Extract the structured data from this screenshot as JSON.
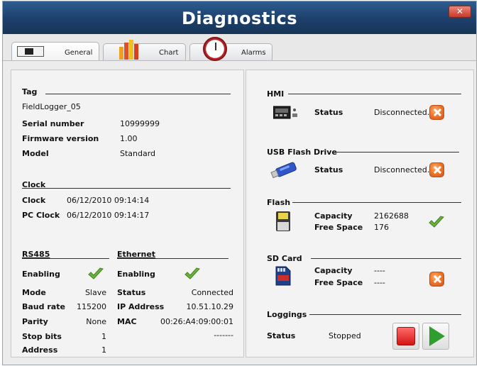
{
  "window": {
    "title": "Diagnostics",
    "close_symbol": "✕"
  },
  "tabs": [
    {
      "label": "General",
      "icon": "tag-grid-icon",
      "active": true
    },
    {
      "label": "Chart",
      "icon": "bar-chart-icon",
      "active": false
    },
    {
      "label": "Alarms",
      "icon": "alarm-clock-icon",
      "active": false
    }
  ],
  "general": {
    "tag": {
      "title": "Tag",
      "name": "FieldLogger_05",
      "rows": [
        {
          "label": "Serial number",
          "value": "10999999"
        },
        {
          "label": "Firmware version",
          "value": "1.00"
        },
        {
          "label": "Model",
          "value": "Standard"
        }
      ]
    },
    "clock": {
      "title": "Clock",
      "rows": [
        {
          "label": "Clock",
          "value": "06/12/2010 09:14:14"
        },
        {
          "label": "PC Clock",
          "value": "06/12/2010 09:14:17"
        }
      ]
    },
    "rs485": {
      "title": "RS485",
      "enabling_label": "Enabling",
      "enabled": true,
      "rows": [
        {
          "label": "Mode",
          "value": "Slave"
        },
        {
          "label": "Baud rate",
          "value": "115200"
        },
        {
          "label": "Parity",
          "value": "None"
        },
        {
          "label": "Stop bits",
          "value": "1"
        },
        {
          "label": "Address",
          "value": "1"
        }
      ]
    },
    "ethernet": {
      "title": "Ethernet",
      "enabling_label": "Enabling",
      "enabled": true,
      "rows": [
        {
          "label": "Status",
          "value": "Connected"
        },
        {
          "label": "IP Address",
          "value": "10.51.10.29"
        },
        {
          "label": "MAC",
          "value": "00:26:A4:09:00:01"
        },
        {
          "label": "",
          "value": "-------"
        }
      ]
    }
  },
  "devices": {
    "hmi": {
      "title": "HMI",
      "status_label": "Status",
      "status_value": "Disconnected."
    },
    "usb": {
      "title": "USB Flash Drive",
      "status_label": "Status",
      "status_value": "Disconnected."
    },
    "flash": {
      "title": "Flash",
      "capacity_label": "Capacity",
      "capacity_value": "2162688",
      "free_label": "Free Space",
      "free_value": "176"
    },
    "sdcard": {
      "title": "SD Card",
      "capacity_label": "Capacity",
      "capacity_value": "----",
      "free_label": "Free Space",
      "free_value": "----"
    },
    "loggings": {
      "title": "Loggings",
      "status_label": "Status",
      "status_value": "Stopped"
    }
  },
  "colors": {
    "title_bar": "#1d3f6b",
    "ok_green": "#5aa32e",
    "error_orange": "#f07a2c",
    "stop_red": "#d41414",
    "play_green": "#2f9e2f"
  }
}
